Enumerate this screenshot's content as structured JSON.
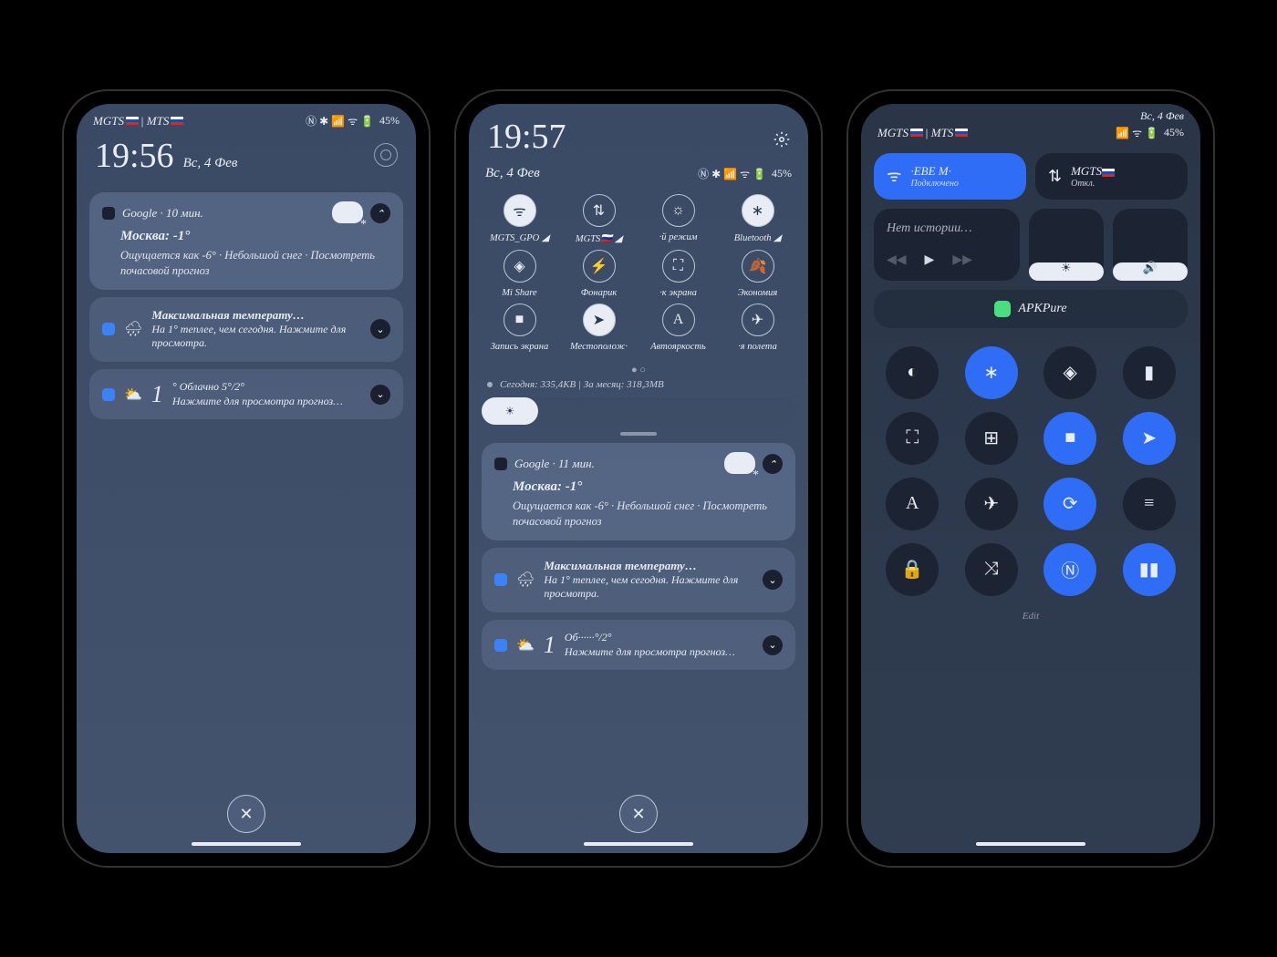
{
  "status": {
    "carrier": "MGTS🇷🇺 | MTS🇷🇺",
    "battery": "45%",
    "icons": "ⓃⒷ 📶 📶 ᯤ ⏻"
  },
  "phone1": {
    "clock": "19:56",
    "date": "Вс, 4 Фев",
    "card1": {
      "app": "Google · 10 мин.",
      "title": "Москва: -1°",
      "body": "Ощущается как -6° · Небольшой снег · Посмотреть почасовой прогноз"
    },
    "card2": {
      "title": "Максимальная температу…",
      "body": "На 1° теплее, чем сегодня. Нажмите для просмотра."
    },
    "card3": {
      "temp": "1",
      "cond": "° Облачно  5°/2°",
      "body": "Нажмите для просмотра прогноз…"
    }
  },
  "phone2": {
    "clock": "19:57",
    "date": "Вс, 4 Фев",
    "qs": [
      {
        "ico": "ᯤ",
        "lbl": "MGTS_GPO ◢",
        "on": true
      },
      {
        "ico": "⇅",
        "lbl": "MGTS🇷🇺 ◢"
      },
      {
        "ico": "☼",
        "lbl": "·й режим"
      },
      {
        "ico": "∗",
        "lbl": "Bluetooth ◢",
        "on": true
      },
      {
        "ico": "◈",
        "lbl": "Mi Share"
      },
      {
        "ico": "⚡",
        "lbl": "Фонарик"
      },
      {
        "ico": "⛶",
        "lbl": "·к экрана"
      },
      {
        "ico": "🍂",
        "lbl": "Экономия"
      },
      {
        "ico": "■",
        "lbl": "Запись экрана"
      },
      {
        "ico": "➤",
        "lbl": "Местополож·",
        "on": true
      },
      {
        "ico": "A",
        "lbl": "Автояркость"
      },
      {
        "ico": "✈",
        "lbl": "·я полета"
      }
    ],
    "data": "Сегодня: 335,4КВ  |  За месяц: 318,3МВ",
    "card1": {
      "app": "Google · 11 мин.",
      "title": "Москва: -1°",
      "body": "Ощущается как -6° · Небольшой снег · Посмотреть почасовой прогноз"
    },
    "card2": {
      "title": "Максимальная температу…",
      "body": "На 1° теплее, чем сегодня. Нажмите для просмотра."
    },
    "card3": {
      "temp": "1",
      "cond": "Об······°/2°",
      "body": "Нажмите для просмотра прогноз…"
    }
  },
  "phone3": {
    "date": "Вс, 4 Фев",
    "wifi": {
      "name": "·EBE    M·",
      "sub": "Подключено"
    },
    "data": {
      "name": "MGTS🇷🇺",
      "sub": "Откл."
    },
    "media_empty": "Нет истории…",
    "app": "APKPure",
    "grid": [
      {
        "ico": "◐"
      },
      {
        "ico": "∗",
        "on": true
      },
      {
        "ico": "◈"
      },
      {
        "ico": "▮"
      },
      {
        "ico": "⛶"
      },
      {
        "ico": "⊞"
      },
      {
        "ico": "■",
        "on": true
      },
      {
        "ico": "➤",
        "on": true
      },
      {
        "ico": "A"
      },
      {
        "ico": "✈"
      },
      {
        "ico": "⟳",
        "on": true
      },
      {
        "ico": "≡"
      },
      {
        "ico": "🔒"
      },
      {
        "ico": "⤨"
      },
      {
        "ico": "Ⓝ",
        "on": true
      },
      {
        "ico": "▮▮",
        "on": true
      }
    ],
    "edit": "Edit"
  }
}
